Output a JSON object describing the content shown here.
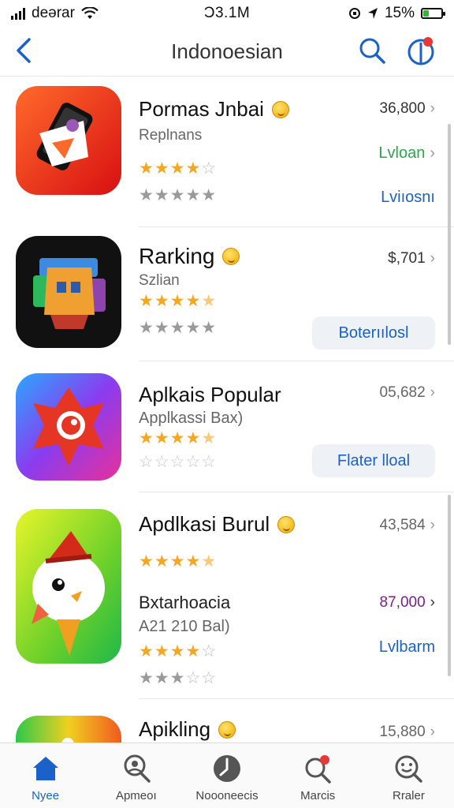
{
  "status_bar": {
    "carrier": "deərar",
    "time": "Ɔ3.1M",
    "battery_percent": "15%"
  },
  "navbar": {
    "title": "Indonoesian"
  },
  "apps": [
    {
      "name": "Pormas Jnbai",
      "subtitle": "Replnans",
      "price": "36,800",
      "link_primary": "Lvloan",
      "link_secondary": "Lviıosnı",
      "rating_primary": 4,
      "rating_secondary": 5
    },
    {
      "name": "Rarking",
      "subtitle": "Szlian",
      "price": "$,701",
      "button": "Boterıılosl",
      "rating_primary": 4.5,
      "rating_secondary": 5
    },
    {
      "name": "Aplkais Popular",
      "subtitle": "Applkassi Bax)",
      "price": "05,682",
      "button": "Flater lloal",
      "rating_primary": 4.5,
      "rating_secondary": 0
    },
    {
      "name": "Apdlkasi Burul",
      "price": "43,584",
      "subtitle2": "Bxtarhoacia",
      "price2": "87,000",
      "subtitle3": "A21 210 Bal)",
      "link_primary": "Lvlbarm",
      "rating_primary": 4.5,
      "rating_secondary": 4,
      "rating_tertiary": 3
    },
    {
      "name": "Apikling",
      "price": "15,880"
    }
  ],
  "tabs": [
    {
      "label": "Nyee",
      "icon": "home-icon",
      "active": true
    },
    {
      "label": "Apmeoı",
      "icon": "search-person-icon",
      "active": false
    },
    {
      "label": "Noooneecis",
      "icon": "clock-icon",
      "active": false
    },
    {
      "label": "Marcis",
      "icon": "notification-search-icon",
      "active": false
    },
    {
      "label": "Rraler",
      "icon": "smiley-search-icon",
      "active": false
    }
  ],
  "colors": {
    "accent": "#1a62c9",
    "star": "#f5a623",
    "green_link": "#2aa84a",
    "badge_red": "#e53935"
  }
}
